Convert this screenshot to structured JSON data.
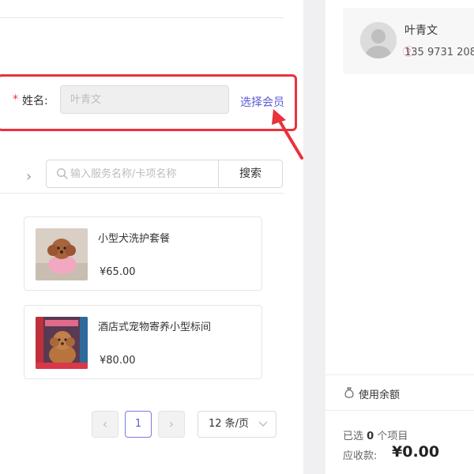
{
  "member_form": {
    "required_mark": "*",
    "name_label": "姓名:",
    "name_placeholder": "叶青文",
    "select_member_link": "选择会员"
  },
  "search": {
    "placeholder": "输入服务名称/卡项名称",
    "button_label": "搜索"
  },
  "products": [
    {
      "name": "小型犬洗护套餐",
      "price": "¥65.00",
      "image": "dog-bath-photo"
    },
    {
      "name": "酒店式宠物寄养小型标间",
      "price": "¥80.00",
      "image": "dog-hotel-photo"
    }
  ],
  "pagination": {
    "current_page": "1",
    "page_size": "12 条/页",
    "prev_icon": "chevron-left-icon",
    "next_icon": "chevron-right-icon"
  },
  "member": {
    "name": "叶青文",
    "phone": "135 9731 208"
  },
  "summary": {
    "balance_label": "使用余额",
    "selected_prefix": "已选",
    "selected_count": "0",
    "selected_suffix": "个项目",
    "receivable_label": "应收款:",
    "receivable_amount": "¥0.00"
  },
  "colors": {
    "annotation_red": "#e8323c",
    "link_purple": "#5b5bd6",
    "background": "#f0f0f2"
  }
}
